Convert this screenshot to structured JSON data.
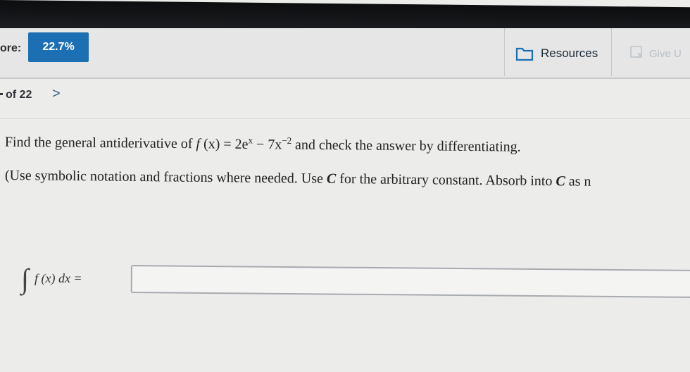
{
  "header": {
    "score_label": "ore:",
    "score_value": "22.7%",
    "resources_label": "Resources",
    "giveup_label": "Give U"
  },
  "nav": {
    "page_text": "of 22",
    "next_glyph": ">"
  },
  "question": {
    "lead": "Find the general antiderivative of ",
    "f": "f",
    "fx_rest": " (x) = 2e",
    "exp1": "x",
    "mid": " − 7x",
    "exp2": "−2",
    "tail": " and check the answer by differentiating."
  },
  "instruction": {
    "part1": "(Use symbolic notation and fractions where needed. Use ",
    "c1": "C",
    "part2": " for the arbitrary constant. Absorb into ",
    "c2": "C",
    "part3": " as n"
  },
  "answer": {
    "integral_sign": "∫",
    "integral_expr": "f (x) dx =",
    "value": ""
  },
  "colors": {
    "accent": "#1d6fb3",
    "background": "#ececeb"
  },
  "icons": {
    "resources": "folder-icon",
    "giveup": "give-up-icon"
  }
}
